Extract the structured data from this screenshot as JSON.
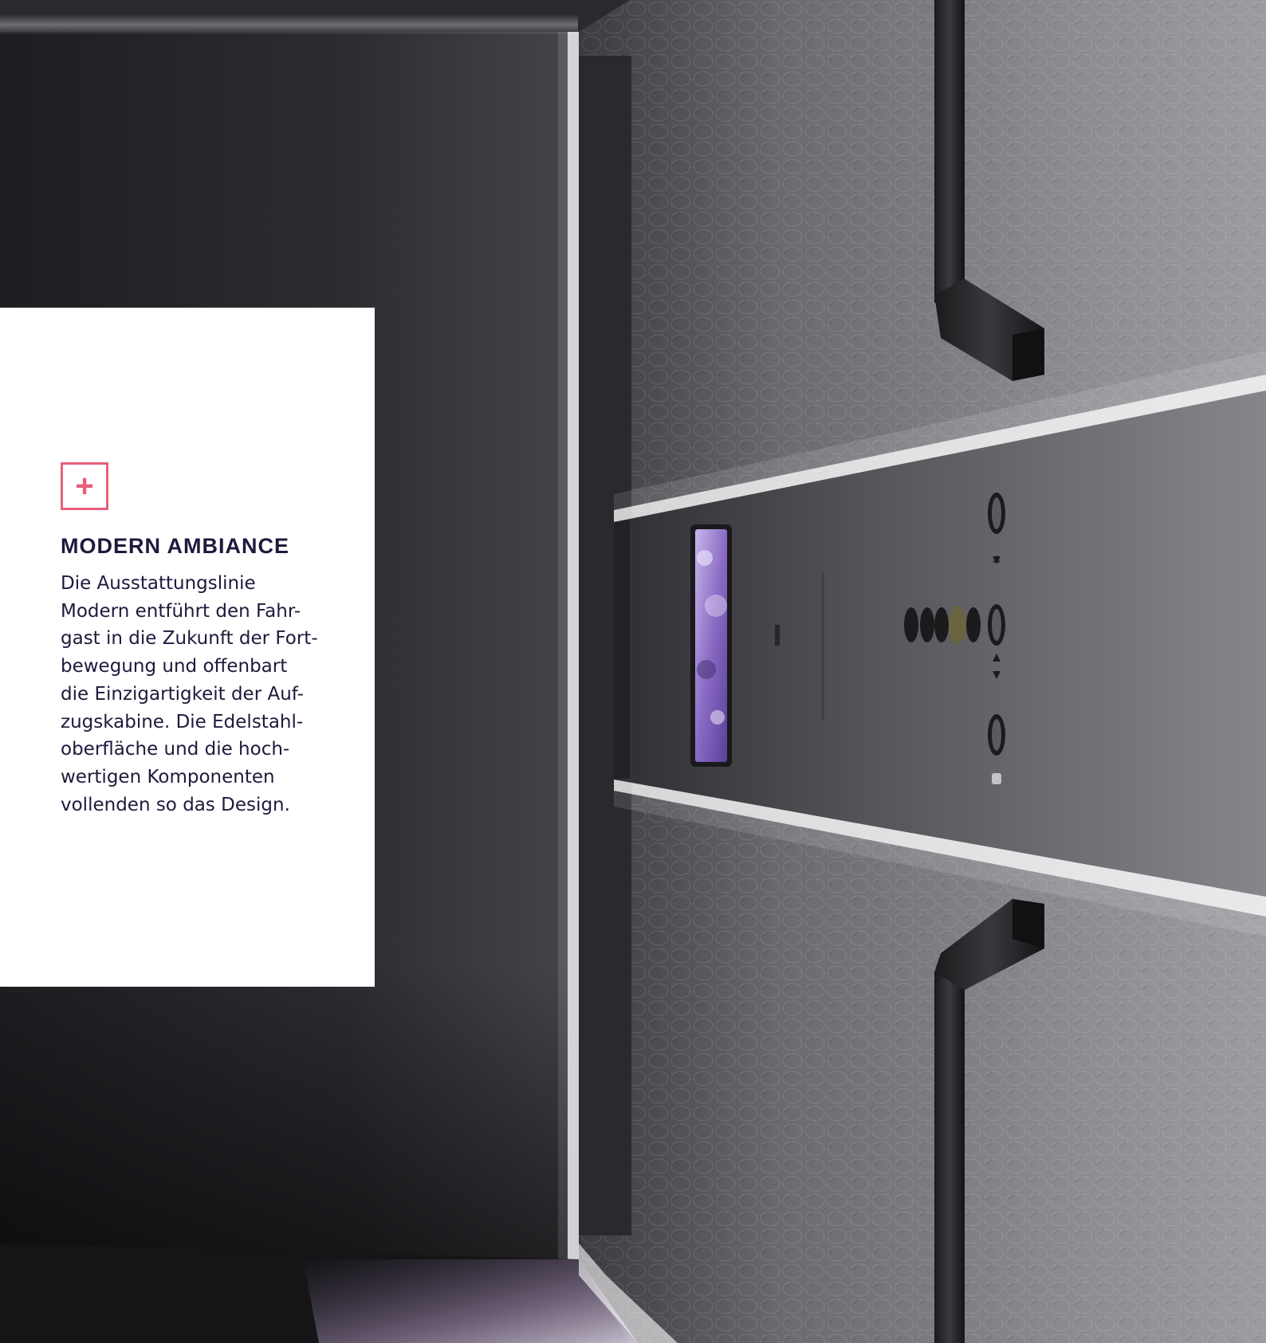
{
  "card": {
    "icon": "plus-icon",
    "icon_glyph": "+",
    "title": "MODERN AMBIANCE",
    "body_lines": [
      "Die Ausstattungslinie",
      "Modern entführt den Fahr-",
      "gast in die Zukunft der Fort-",
      "bewegung und offenbart",
      "die Einzigartigkeit der Auf-",
      "zugskabine. Die Edelstahl-",
      "oberfläche und die hoch-",
      "wertigen Komponenten",
      "vollenden so das Design."
    ]
  },
  "colors": {
    "accent": "#e8607c",
    "text": "#1d1a3d",
    "card_bg": "#ffffff",
    "display_purple": "#8a6bc4"
  },
  "photo": {
    "subject": "elevator-cabin-interior",
    "icons": [
      "handrail-icon",
      "display-screen-icon",
      "call-button-icon"
    ]
  }
}
